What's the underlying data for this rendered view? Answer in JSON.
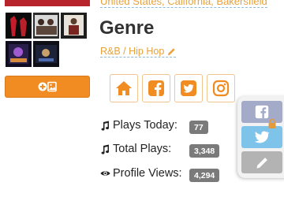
{
  "profile": {
    "location": "United States, California, Bakersfield",
    "genre_heading": "Genre",
    "genre_value": "R&B / Hip Hop"
  },
  "stats": [
    {
      "icon": "music-note-icon",
      "label": "Plays Today:",
      "value": "77"
    },
    {
      "icon": "music-note-icon",
      "label": "Total Plays:",
      "value": "3,348"
    },
    {
      "icon": "eye-icon",
      "label": "Profile Views:",
      "value": "4,294"
    }
  ],
  "social_links": [
    "home-icon",
    "facebook-icon",
    "twitter-icon",
    "instagram-icon"
  ],
  "share_panel": [
    "facebook-share",
    "twitter-share",
    "edit"
  ],
  "colors": {
    "accent_orange": "#f08c22",
    "link_orange": "#e7a23c",
    "badge_gray": "#7a7a7a",
    "facebook": "#a3abc8",
    "twitter": "#7ec3ea"
  }
}
